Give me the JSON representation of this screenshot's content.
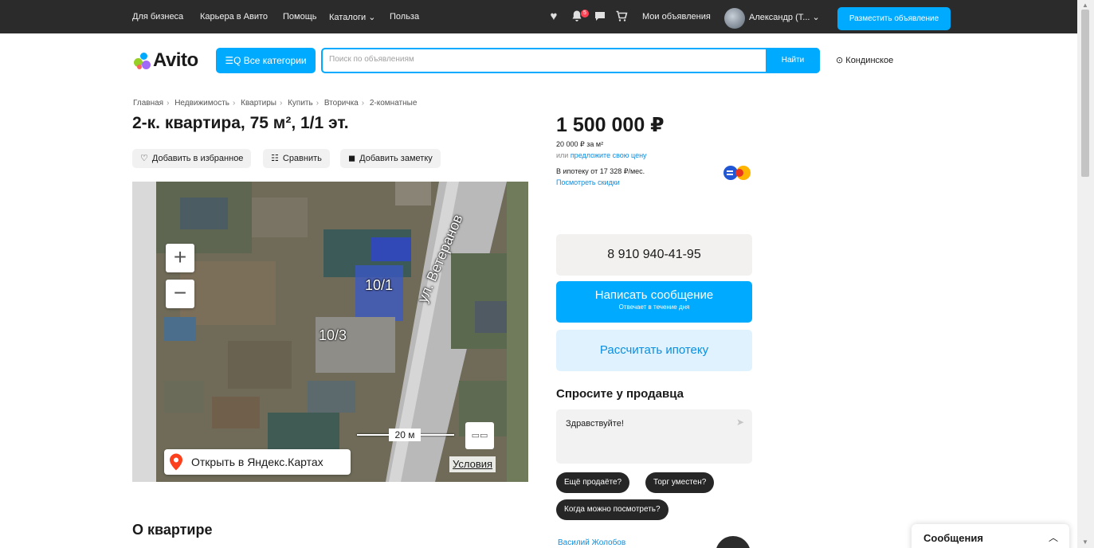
{
  "topbar": {
    "links": [
      "Для бизнеса",
      "Карьера в Авито",
      "Помощь",
      "Каталоги ⌄",
      "Польза"
    ],
    "icons": [
      "heart-icon",
      "bell-icon",
      "chat-icon",
      "cart-icon"
    ],
    "notification_count": "5",
    "my_ads": "Мои объявления",
    "user_name": "Александр (Т... ⌄",
    "post_button": "Разместить объявление"
  },
  "header": {
    "logo_text": "Avito",
    "categories_button": "☰Q Все категории",
    "search_placeholder": "Поиск по объявлениям",
    "search_value": "",
    "find_button": "Найти",
    "location": "Кондинское"
  },
  "breadcrumbs": [
    "Главная",
    "Недвижимость",
    "Квартиры",
    "Купить",
    "Вторичка",
    "2-комнатные"
  ],
  "listing": {
    "title": "2-к. квартира, 75 м², 1/1 эт.",
    "actions": {
      "favorite": "Добавить в избранное",
      "compare": "Сравнить",
      "note": "Добавить заметку"
    }
  },
  "map": {
    "labels": {
      "house_a": "10/1",
      "house_b": "10/3",
      "street": "ул. Ветеранов"
    },
    "zoom_in": "+",
    "zoom_out": "−",
    "scale": "20 м",
    "open_yandex": "Открыть в Яндекс.Картах",
    "terms": "Условия"
  },
  "about_heading": "О квартире",
  "pricing": {
    "price": "1 500 000 ₽",
    "per_meter": "20 000 ₽ за м²",
    "offer_prefix": "или ",
    "offer_link": "предложите свою цену",
    "mortgage": "В ипотеку от 17 328 ₽/мес.",
    "discounts_link": "Посмотреть скидки"
  },
  "contact": {
    "phone": "8 910 940-41-95",
    "message_button": "Написать сообщение",
    "message_sub": "Отвечает в течение дня",
    "mortgage_button": "Рассчитать ипотеку"
  },
  "ask": {
    "title": "Спросите у продавца",
    "message_value": "Здравствуйте!",
    "quick_questions": [
      "Ещё продаёте?",
      "Торг уместен?",
      "Когда можно посмотреть?"
    ]
  },
  "seller": {
    "name": "Василий Жолобов"
  },
  "messages_popup": {
    "title": "Сообщения"
  },
  "colors": {
    "accent": "#00aaff",
    "topbar": "#2b2b2b",
    "link": "#0a8ee0",
    "chip_dark": "#262626"
  }
}
